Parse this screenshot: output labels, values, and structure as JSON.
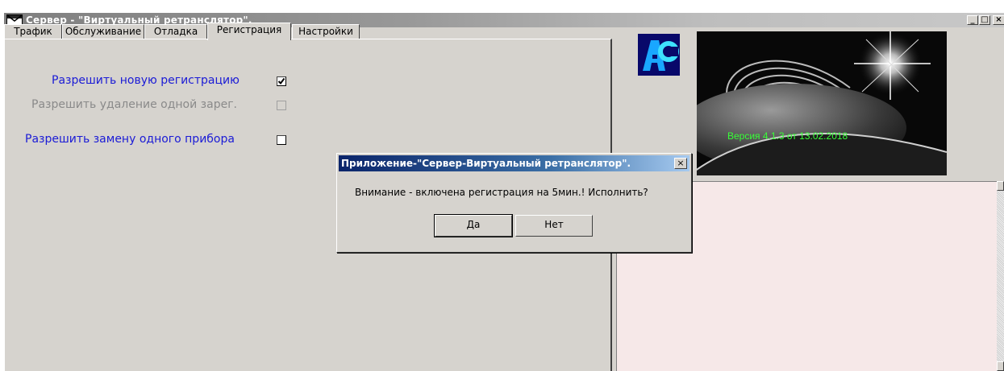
{
  "window": {
    "title": "Сервер - \"Виртуальный ретранслятор\".",
    "minimize_label": "_",
    "restore_label": "□",
    "close_label": "×"
  },
  "tabs": [
    {
      "label": "Трафик",
      "active": false
    },
    {
      "label": "Обслуживание",
      "active": false
    },
    {
      "label": "Отладка",
      "active": false
    },
    {
      "label": "Регистрация",
      "active": true
    },
    {
      "label": "Настройки",
      "active": false
    }
  ],
  "registration": {
    "allow_new": {
      "label": "Разрешить новую регистрацию",
      "checked": true,
      "enabled": true
    },
    "allow_delete_one": {
      "label": "Разрешить удаление одной зарег.",
      "checked": false,
      "enabled": false
    },
    "allow_replace_device": {
      "label": "Разрешить замену одного прибора",
      "checked": false,
      "enabled": true
    }
  },
  "banner": {
    "version_text": "Версия   4.1.3 от 13.02.2018",
    "version_color": "#38ff38"
  },
  "logo": {
    "text": "AC",
    "icon": "app-logo-icon"
  },
  "dialog": {
    "title": "Приложение-\"Сервер-Виртуальный ретранслятор\".",
    "close_label": "×",
    "message": "Внимание - включена регистрация на 5мин.! Исполнить?",
    "yes_label": "Да",
    "no_label": "Нет"
  },
  "colors": {
    "label_blue": "#1b1bd6",
    "dialog_title": "#0a246a",
    "log_background": "#f6e8e8"
  }
}
